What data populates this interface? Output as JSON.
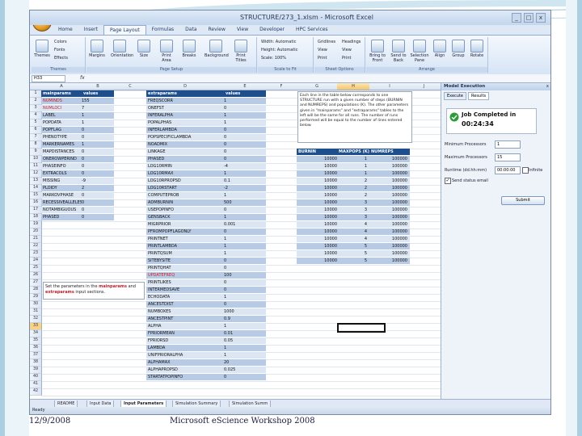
{
  "window": {
    "title": "STRUCTURE/273_1.xlsm - Microsoft Excel",
    "min": "_",
    "max": "□",
    "close": "x"
  },
  "ribbon": {
    "tabs": [
      "Home",
      "Insert",
      "Page Layout",
      "Formulas",
      "Data",
      "Review",
      "View",
      "Developer",
      "HPC Services"
    ],
    "active_tab": "Page Layout",
    "groups": {
      "themes": {
        "name": "Themes",
        "buttons": [
          "Themes"
        ],
        "small": [
          "Colors",
          "Fonts",
          "Effects"
        ]
      },
      "page_setup": {
        "name": "Page Setup",
        "buttons": [
          "Margins",
          "Orientation",
          "Size",
          "Print Area",
          "Breaks",
          "Background",
          "Print Titles"
        ]
      },
      "scale": {
        "name": "Scale to Fit",
        "rows": [
          "Width: Automatic",
          "Height: Automatic",
          "Scale: 100%"
        ]
      },
      "sheet_options": {
        "name": "Sheet Options",
        "cols": [
          "Gridlines",
          "Headings"
        ],
        "rows": [
          "View",
          "Print"
        ]
      },
      "arrange": {
        "name": "Arrange",
        "buttons": [
          "Bring to Front",
          "Send to Back",
          "Selection Pane",
          "Align",
          "Group",
          "Rotate"
        ]
      }
    }
  },
  "formula_bar": {
    "name_box": "H33",
    "fx": "fx",
    "value": ""
  },
  "columns": [
    "A",
    "B",
    "C",
    "D",
    "E",
    "F",
    "G",
    "H",
    "I",
    "J",
    "K"
  ],
  "selected_col": "H",
  "selected_row": "33",
  "rows": [
    "1",
    "2",
    "3",
    "4",
    "5",
    "6",
    "7",
    "8",
    "9",
    "10",
    "11",
    "12",
    "13",
    "14",
    "15",
    "16",
    "17",
    "18",
    "19",
    "20",
    "21",
    "22",
    "23",
    "24",
    "25",
    "26",
    "27",
    "28",
    "29",
    "30",
    "31",
    "32",
    "33",
    "34",
    "35",
    "36",
    "37",
    "38",
    "39",
    "40",
    "41",
    "42"
  ],
  "mainparams": {
    "header": [
      "mainparams",
      "values"
    ],
    "items": [
      [
        "NUMINDS",
        "155"
      ],
      [
        "NUMLOCI",
        "7"
      ],
      [
        "LABEL",
        "1"
      ],
      [
        "POPDATA",
        "1"
      ],
      [
        "POPFLAG",
        "0"
      ],
      [
        "PHENOTYPE",
        "0"
      ],
      [
        "MARKERNAMES",
        "1"
      ],
      [
        "MAPDISTANCES",
        "0"
      ],
      [
        "ONEROWPERIND",
        "0"
      ],
      [
        "PHASEINFO",
        "0"
      ],
      [
        "EXTRACOLS",
        "0"
      ],
      [
        "MISSING",
        "-9"
      ],
      [
        "PLOIDY",
        "2"
      ],
      [
        "MARKOVPHASE",
        "0"
      ],
      [
        "RECESSIVEALLELES",
        "0"
      ],
      [
        "NOTAMBIGUOUS",
        "0"
      ],
      [
        "PHASED",
        "0"
      ]
    ]
  },
  "extraparams": {
    "header": [
      "extraparams",
      "values"
    ],
    "items": [
      [
        "FREQSCORR",
        "1"
      ],
      [
        "ONEFST",
        "0"
      ],
      [
        "INFERALPHA",
        "1"
      ],
      [
        "POPALPHAS",
        "1"
      ],
      [
        "INFERLAMBDA",
        "0"
      ],
      [
        "POPSPECIFICLAMBDA",
        "0"
      ],
      [
        "NOADMIX",
        "0"
      ],
      [
        "LINKAGE",
        "0"
      ],
      [
        "PHASED",
        "0"
      ],
      [
        "LOG10RMIN",
        "-4"
      ],
      [
        "LOG10RMAX",
        "1"
      ],
      [
        "LOG10RPROPSD",
        "0.1"
      ],
      [
        "LOG10RSTART",
        "-2"
      ],
      [
        "COMPUTEPROB",
        "1"
      ],
      [
        "ADMBURNIN",
        "500"
      ],
      [
        "USEPOPINFO",
        "0"
      ],
      [
        "GENSBACK",
        "1"
      ],
      [
        "MIGRPRIOR",
        "0.001"
      ],
      [
        "PFROMPOPFLAGONLY",
        "0"
      ],
      [
        "PRINTNET",
        "1"
      ],
      [
        "PRINTLAMBDA",
        "1"
      ],
      [
        "PRINTQSUM",
        "1"
      ],
      [
        "SITEBYSITE",
        "0"
      ],
      [
        "PRINTQHAT",
        "0"
      ],
      [
        "UPDATEFREQ",
        "100"
      ],
      [
        "PRINTLIKES",
        "0"
      ],
      [
        "INTERMEDSAVE",
        "0"
      ],
      [
        "ECHODATA",
        "1"
      ],
      [
        "ANCESTDIST",
        "0"
      ],
      [
        "NUMBOXES",
        "1000"
      ],
      [
        "ANCESTPINT",
        "0.9"
      ],
      [
        "ALPHA",
        "1"
      ],
      [
        "FPRIORMEAN",
        "0.01"
      ],
      [
        "FPRIORSD",
        "0.05"
      ],
      [
        "LAMBDA",
        "1"
      ],
      [
        "UNIFPRIORALPHA",
        "1"
      ],
      [
        "ALPHAMAX",
        "20"
      ],
      [
        "ALPHAPROPSD",
        "0.025"
      ],
      [
        "STARTATPOPINFO",
        "0"
      ]
    ]
  },
  "runs": {
    "header": [
      "BURNIN",
      "MAXPOPS (K)",
      "NUMREPS"
    ],
    "items": [
      [
        "10000",
        "1",
        "100000"
      ],
      [
        "10000",
        "1",
        "100000"
      ],
      [
        "10000",
        "1",
        "100000"
      ],
      [
        "10000",
        "2",
        "100000"
      ],
      [
        "10000",
        "2",
        "100000"
      ],
      [
        "10000",
        "2",
        "100000"
      ],
      [
        "10000",
        "3",
        "100000"
      ],
      [
        "10000",
        "3",
        "100000"
      ],
      [
        "10000",
        "3",
        "100000"
      ],
      [
        "10000",
        "4",
        "100000"
      ],
      [
        "10000",
        "4",
        "100000"
      ],
      [
        "10000",
        "4",
        "100000"
      ],
      [
        "10000",
        "5",
        "100000"
      ],
      [
        "10000",
        "5",
        "100000"
      ],
      [
        "10000",
        "5",
        "100000"
      ]
    ]
  },
  "runs_note": "Each line in the table below corresponds to one STRUCTURE run with a given number of steps (BURNIN and NUMREPS) and populations (K). The other parameters given in \"mainparams\" and \"extraparams\" tables to the left will be the same for all runs. The number of runs performed will be equal to the number of lines entered below.",
  "params_note": {
    "prefix": "Set the parameters in the",
    "main": "mainparams",
    "and": "and",
    "extra": "extraparams",
    "suffix": "input sections."
  },
  "sheet_tabs": [
    "README",
    "Input Data",
    "Input Parameters",
    "Simulation Summary",
    "Simulation Summ"
  ],
  "active_sheet": "Input Parameters",
  "status": "Ready",
  "pane": {
    "title": "Model Execution",
    "close": "x",
    "tabs": [
      "Execute",
      "Results"
    ],
    "job_status": "Job Completed in",
    "job_time": "00:24:34",
    "fields": [
      {
        "label": "Minimum Processors",
        "value": "1"
      },
      {
        "label": "Maximum Processors",
        "value": "15"
      },
      {
        "label": "Runtime (dd.hh:mm)",
        "value": "00:00:00"
      }
    ],
    "infinite_label": "Infinite",
    "send_status_label": "Send status email",
    "submit_label": "Submit"
  },
  "footer": {
    "date": "12/9/2008",
    "title": "Microsoft eScience Workshop 2008"
  },
  "colors": {
    "header_fill": "#1f4e8c",
    "band_dark": "#b8cbe6",
    "band_light": "#dce6f3",
    "accent_red": "#c0202a",
    "selection": "#f8d286"
  }
}
